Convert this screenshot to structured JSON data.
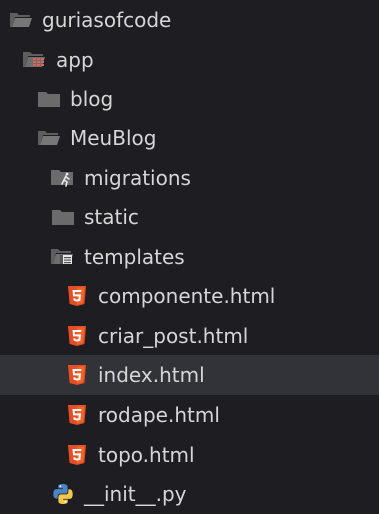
{
  "explorer": {
    "items": [
      {
        "label": "guriasofcode",
        "icon": "folder-open-icon"
      },
      {
        "label": "app",
        "icon": "app-folder-open-icon"
      },
      {
        "label": "blog",
        "icon": "folder-icon"
      },
      {
        "label": "MeuBlog",
        "icon": "folder-open-icon"
      },
      {
        "label": "migrations",
        "icon": "migrations-folder-icon"
      },
      {
        "label": "static",
        "icon": "folder-icon"
      },
      {
        "label": "templates",
        "icon": "templates-folder-open-icon"
      },
      {
        "label": "componente.html",
        "icon": "html5-icon"
      },
      {
        "label": "criar_post.html",
        "icon": "html5-icon"
      },
      {
        "label": "index.html",
        "icon": "html5-icon",
        "selected": true
      },
      {
        "label": "rodape.html",
        "icon": "html5-icon"
      },
      {
        "label": "topo.html",
        "icon": "html5-icon"
      },
      {
        "label": "__init__.py",
        "icon": "python-icon"
      }
    ]
  },
  "colors": {
    "background": "#1e1e22",
    "selected_row": "#323338",
    "folder": "#6b6b6b",
    "html5": "#e44d26",
    "python_blue": "#4a86c5",
    "python_yellow": "#f2c94c",
    "app_grid": "#e0625c"
  }
}
